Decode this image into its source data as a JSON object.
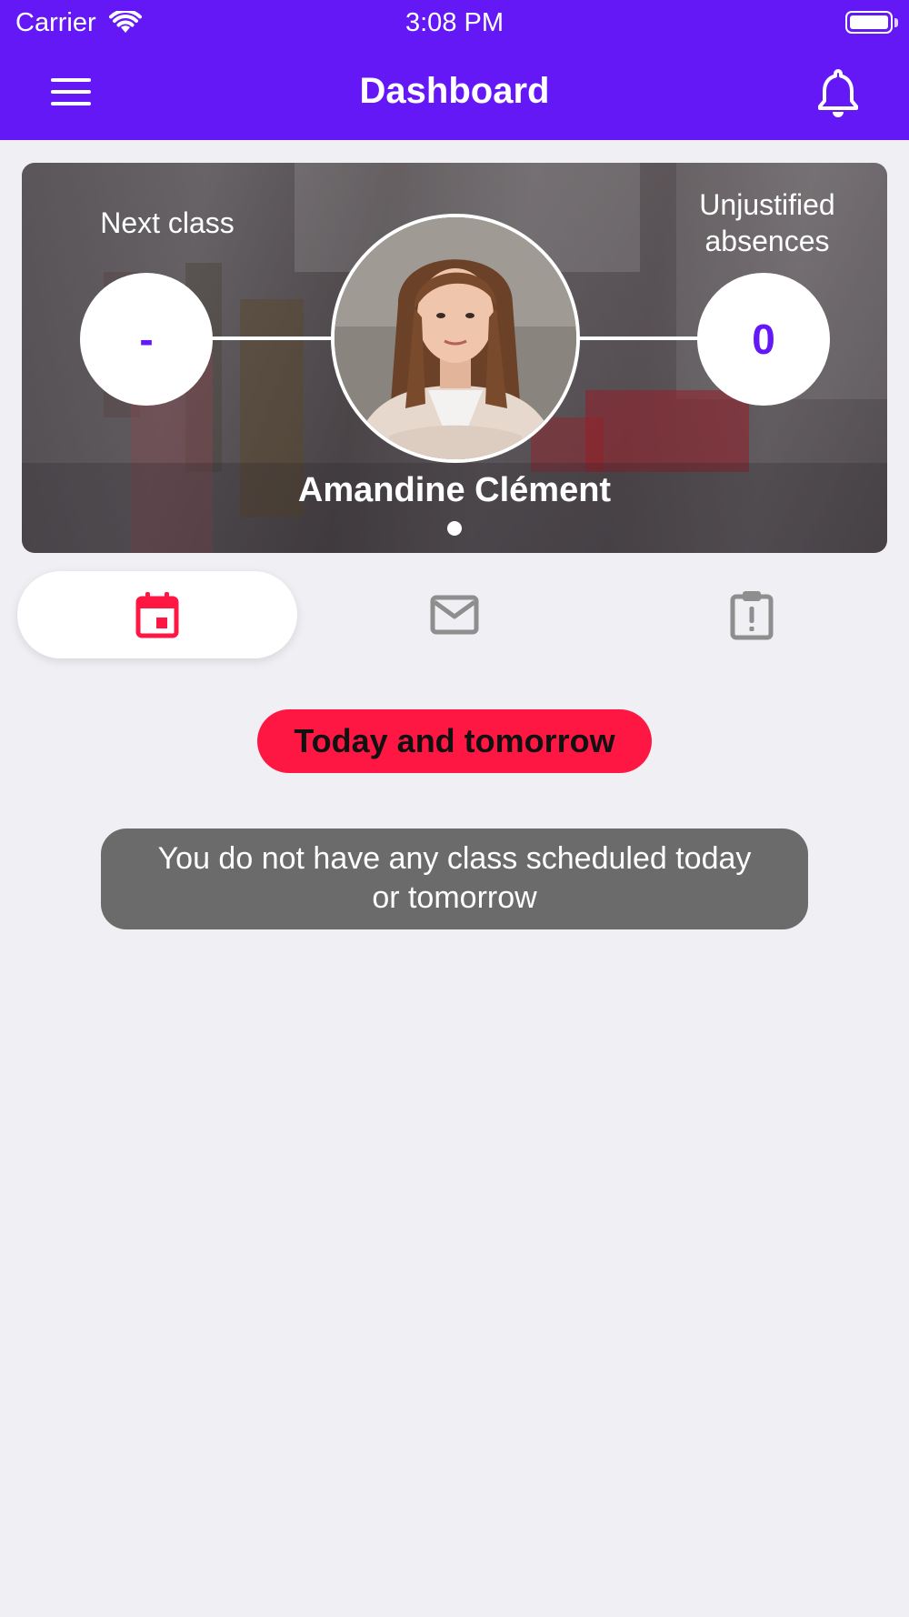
{
  "status_bar": {
    "carrier": "Carrier",
    "time": "3:08 PM"
  },
  "nav": {
    "title": "Dashboard",
    "menu_icon": "hamburger-menu-icon",
    "bell_icon": "bell-icon"
  },
  "profile": {
    "name": "Amandine Clément",
    "next_class": {
      "label": "Next class",
      "value": "-"
    },
    "absences": {
      "label_line1": "Unjustified",
      "label_line2": "absences",
      "value": "0"
    }
  },
  "tabs": [
    {
      "icon": "calendar-icon",
      "active": true
    },
    {
      "icon": "mail-icon",
      "active": false
    },
    {
      "icon": "clipboard-alert-icon",
      "active": false
    }
  ],
  "schedule": {
    "section_title": "Today and tomorrow",
    "empty_line1": "You do not have any class scheduled today",
    "empty_line2": "or tomorrow"
  },
  "colors": {
    "primary": "#6418f6",
    "accent": "#ff1744",
    "background": "#efeff4"
  }
}
